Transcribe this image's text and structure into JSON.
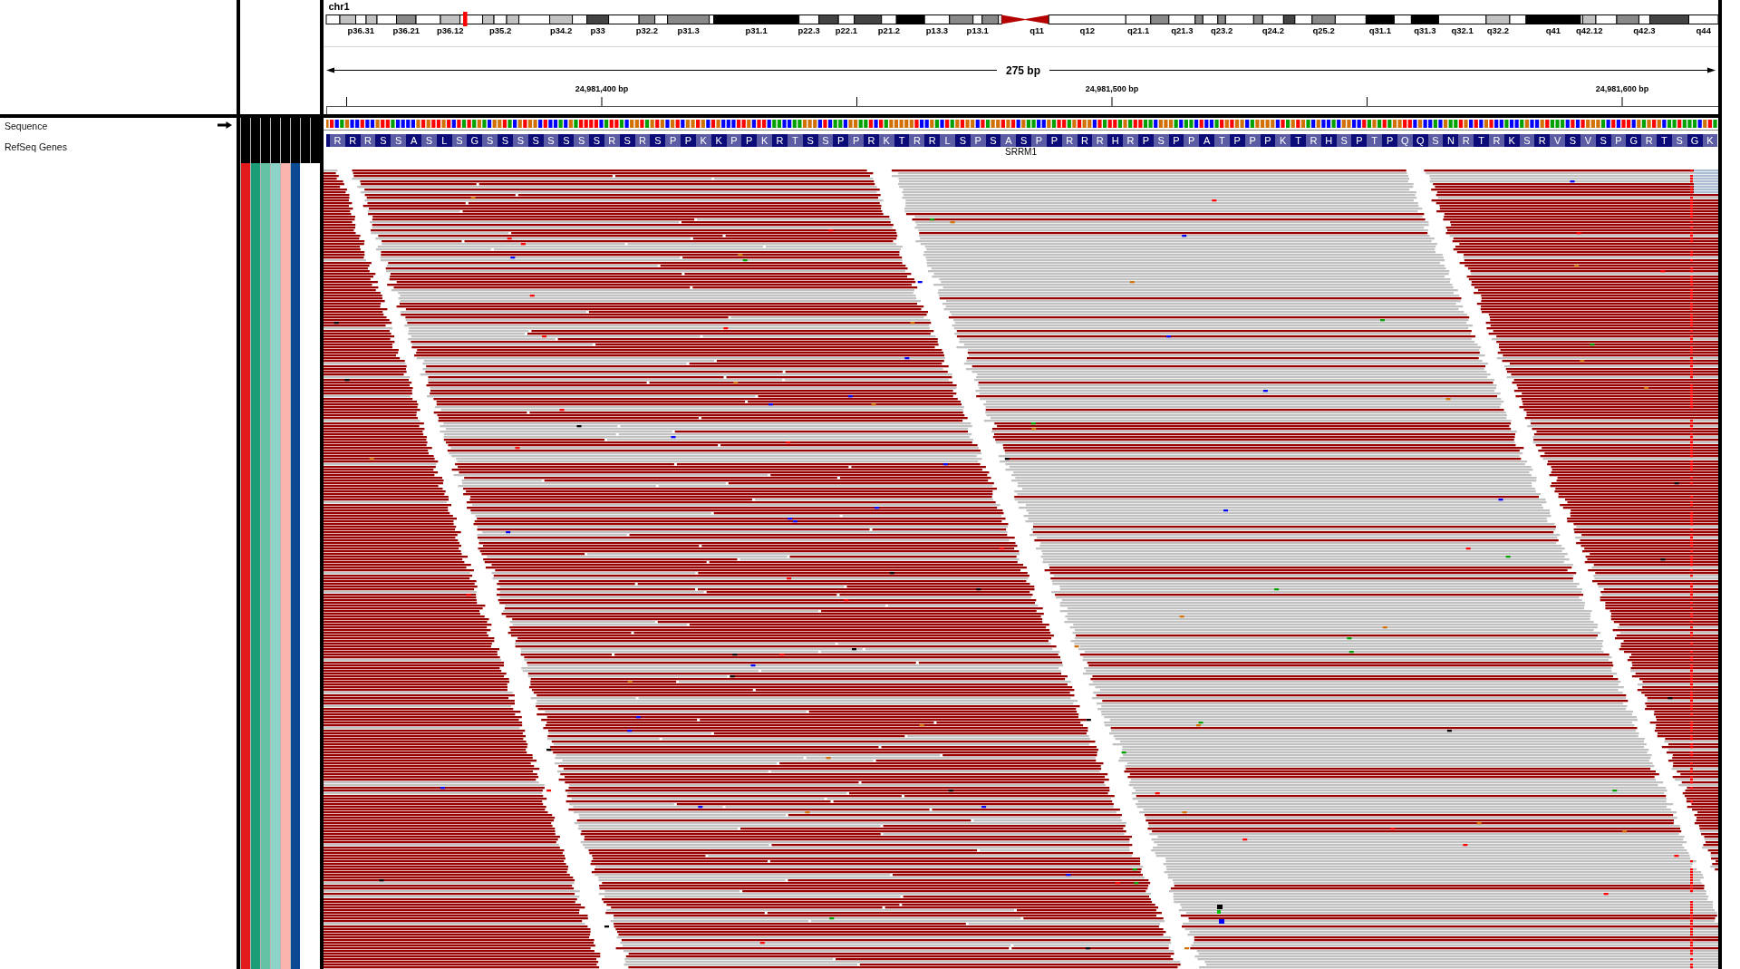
{
  "header": {
    "chromosome": "chr1",
    "ideogram": {
      "bands": [
        {
          "kind": "gneg",
          "current": false
        },
        {
          "kind": "gpos25",
          "current": false
        },
        {
          "kind": "gneg",
          "label": "p36.31",
          "current": false
        },
        {
          "kind": "gpos25",
          "current": false
        },
        {
          "kind": "gneg",
          "current": false
        },
        {
          "kind": "gpos50",
          "label": "p36.21",
          "current": false
        },
        {
          "kind": "gneg",
          "current": false
        },
        {
          "kind": "gpos25",
          "label": "p36.12",
          "current": false
        },
        {
          "kind": "gneg",
          "current": true
        },
        {
          "kind": "gpos25",
          "current": false
        },
        {
          "kind": "gneg",
          "label": "p35.2",
          "current": false
        },
        {
          "kind": "gpos25",
          "current": false
        },
        {
          "kind": "gneg",
          "current": false
        },
        {
          "kind": "gpos25",
          "label": "p34.2",
          "current": false
        },
        {
          "kind": "gneg",
          "current": false
        },
        {
          "kind": "gpos75",
          "label": "p33",
          "current": false
        },
        {
          "kind": "gneg",
          "current": false
        },
        {
          "kind": "gpos50",
          "label": "p32.2",
          "current": false
        },
        {
          "kind": "gneg",
          "current": false
        },
        {
          "kind": "gpos50",
          "label": "p31.3",
          "current": false
        },
        {
          "kind": "gneg",
          "current": false
        },
        {
          "kind": "gpos100",
          "label": "p31.1",
          "current": false
        },
        {
          "kind": "gneg",
          "label": "p22.3",
          "current": false
        },
        {
          "kind": "gpos75",
          "current": false
        },
        {
          "kind": "gneg",
          "label": "p22.1",
          "current": false
        },
        {
          "kind": "gpos75",
          "current": false
        },
        {
          "kind": "gneg",
          "label": "p21.2",
          "current": false
        },
        {
          "kind": "gpos100",
          "current": false
        },
        {
          "kind": "gneg",
          "label": "p13.3",
          "current": false
        },
        {
          "kind": "gpos50",
          "current": false
        },
        {
          "kind": "gneg",
          "label": "p13.1",
          "current": false
        },
        {
          "kind": "gpos50",
          "current": false
        },
        {
          "kind": "gneg",
          "current": false
        },
        {
          "kind": "acen",
          "current": false
        },
        {
          "kind": "acen",
          "label": "q11",
          "current": false
        },
        {
          "kind": "gneg",
          "label": "q12",
          "current": false
        },
        {
          "kind": "gneg",
          "label": "q21.1",
          "current": false
        },
        {
          "kind": "gpos50",
          "current": false
        },
        {
          "kind": "gneg",
          "label": "q21.3",
          "current": false
        },
        {
          "kind": "gpos50",
          "current": false
        },
        {
          "kind": "gneg",
          "current": false
        },
        {
          "kind": "gpos50",
          "label": "q23.2",
          "current": false
        },
        {
          "kind": "gneg",
          "current": false
        },
        {
          "kind": "gpos50",
          "current": false
        },
        {
          "kind": "gneg",
          "label": "q24.2",
          "current": false
        },
        {
          "kind": "gpos75",
          "current": false
        },
        {
          "kind": "gneg",
          "current": false
        },
        {
          "kind": "gpos50",
          "label": "q25.2",
          "current": false
        },
        {
          "kind": "gneg",
          "current": false
        },
        {
          "kind": "gpos100",
          "label": "q31.1",
          "current": false
        },
        {
          "kind": "gneg",
          "current": false
        },
        {
          "kind": "gpos100",
          "label": "q31.3",
          "current": false
        },
        {
          "kind": "gneg",
          "label": "q32.1",
          "current": false
        },
        {
          "kind": "gpos25",
          "label": "q32.2",
          "current": false
        },
        {
          "kind": "gneg",
          "current": false
        },
        {
          "kind": "gpos100",
          "label": "q41",
          "current": false
        },
        {
          "kind": "gneg",
          "current": false
        },
        {
          "kind": "gpos25",
          "label": "q42.12",
          "current": false
        },
        {
          "kind": "gneg",
          "current": false
        },
        {
          "kind": "gpos50",
          "current": false
        },
        {
          "kind": "gneg",
          "label": "q42.3",
          "current": false
        },
        {
          "kind": "gpos75",
          "current": false
        },
        {
          "kind": "gneg",
          "label": "q44",
          "current": false
        }
      ]
    },
    "ruler": {
      "span": "275 bp",
      "ticks": [
        {
          "label": "24,981,400 bp"
        },
        {
          "label": "24,981,500 bp"
        },
        {
          "label": "24,981,600 bp"
        }
      ]
    }
  },
  "name_panel": {
    "tracks": [
      {
        "kind": "sequence",
        "name": "Sequence",
        "forward": true
      },
      {
        "kind": "gene",
        "name": "RefSeq Genes"
      }
    ]
  },
  "attribute_panel": {
    "columns": [
      {
        "color": "#e31a1c"
      },
      {
        "color": "#1b9e77"
      },
      {
        "color": "#66c2a5"
      },
      {
        "color": "#8dd3c7"
      },
      {
        "color": "#fbb4ae"
      },
      {
        "color": "#0c4a94"
      }
    ]
  },
  "gene_track": {
    "gene": "SRRM1",
    "amino_acids": [
      "R",
      "R",
      "R",
      "S",
      "S",
      "A",
      "S",
      "L",
      "S",
      "G",
      "S",
      "S",
      "S",
      "S",
      "S",
      "S",
      "S",
      "S",
      "R",
      "S",
      "R",
      "S",
      "P",
      "P",
      "K",
      "K",
      "P",
      "P",
      "K",
      "R",
      "T",
      "S",
      "S",
      "P",
      "P",
      "R",
      "K",
      "T",
      "R",
      "R",
      "L",
      "S",
      "P",
      "S",
      "A",
      "S",
      "P",
      "P",
      "R",
      "R",
      "R",
      "H",
      "R",
      "P",
      "S",
      "P",
      "P",
      "A",
      "T",
      "P",
      "P",
      "P",
      "K",
      "T",
      "R",
      "H",
      "S",
      "P",
      "T",
      "P",
      "Q",
      "Q",
      "S",
      "N",
      "R",
      "T",
      "R",
      "K",
      "S",
      "R",
      "V",
      "S",
      "V",
      "S",
      "P",
      "G",
      "R",
      "T",
      "S",
      "G",
      "K"
    ]
  }
}
